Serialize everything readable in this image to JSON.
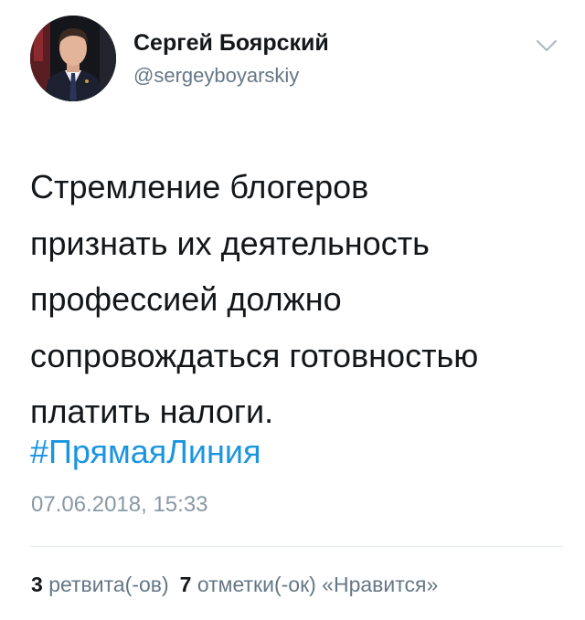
{
  "author": {
    "name": "Сергей Боярский",
    "handle": "@sergeyboyarskiy",
    "avatar_icon": "user-avatar-photo"
  },
  "menu_icon": "chevron-down-icon",
  "tweet": {
    "lines": [
      "Стремление блогеров",
      "признать их деятельность",
      "профессией должно",
      "сопровождаться готовностью",
      "платить налоги."
    ],
    "hashtag": "#ПрямаяЛиния",
    "timestamp": "07.06.2018, 15:33"
  },
  "stats": {
    "retweets_count": "3",
    "retweets_label": "ретвита(-ов)",
    "likes_count": "7",
    "likes_label": "отметки(-ок) «Нравится»"
  },
  "colors": {
    "text": "#14171a",
    "secondary": "#657786",
    "timestamp": "#8899a6",
    "link": "#1b95e0",
    "divider": "#e6ecf0"
  }
}
